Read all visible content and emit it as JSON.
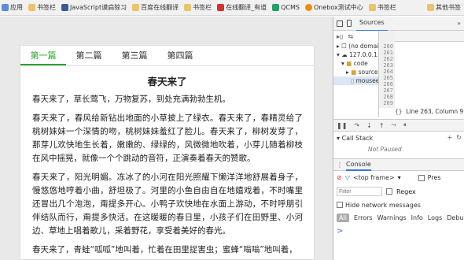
{
  "bookmarks": [
    {
      "icon": "apps-icon",
      "label": "应用"
    },
    {
      "icon": "folder-icon",
      "label": "书签栏"
    },
    {
      "icon": "facebook-icon",
      "label": "JavaScript谟扃猄习"
    },
    {
      "icon": "folder-icon",
      "label": "百度在线翻译"
    },
    {
      "icon": "folder-icon",
      "label": "书签栏"
    },
    {
      "icon": "youdao-icon",
      "label": "在线翻译_有道"
    },
    {
      "icon": "qcms-icon",
      "label": "QCMS"
    },
    {
      "icon": "onebox-icon",
      "label": "Onebox测试中心"
    },
    {
      "icon": "folder-icon",
      "label": "书签栏"
    }
  ],
  "bookmarks_right": "其他书签",
  "article": {
    "tabs": [
      {
        "label": "第一篇",
        "active": true
      },
      {
        "label": "第二篇",
        "active": false
      },
      {
        "label": "第三篇",
        "active": false
      },
      {
        "label": "第四篇",
        "active": false
      }
    ],
    "title": "春天来了",
    "paragraphs": [
      "春天来了，草长莺飞，万物复苏，到处充满勃勃生机。",
      "春天来了，春风给新钻出地面的小草披上了绿衣。春天来了，春精灵给了桃树妹妹一个深情的吻，桃树妹妹羞红了脸儿。春天来了，柳树发芽了，那芽儿欢快地生长着，嫩嫩的、绿绿的，风微微地吹着，小芽儿随着柳枝在风中摇晃，就像一个个跳动的音符，正演奏着春天的赞歌。",
      "春天来了，阳光明媚。冻冰了的小河在阳光照耀下懒洋洋地舒展着身子，慢悠悠地哼着小曲，舒坦极了。河里的小鱼自由自在地嬉戏着，不时嘴里还冒出几个泡泡，甭提多开心。小鸭子欢快地在水面上游动，不时呼朋引伴结队而行，甭提多快活。在这暖暖的春日里，小孩子们在田野里、小河边、草地上唱着歌儿，采着野花，享受着美好的春光。",
      "春天来了，青蛙“呱呱”地叫着，忙着在田里捉害虫；蜜蜂“嗡嗡”地叫着，"
    ]
  },
  "devtools": {
    "top_tabs": [
      "Sources",
      "»"
    ],
    "nav_items": [
      "(no domain",
      "127.0.0.1:8",
      "code",
      "source",
      "mouseev"
    ],
    "line_numbers": [
      "260",
      "261",
      "262",
      "263",
      "264",
      "265",
      "266",
      "267",
      "268",
      "269"
    ],
    "status": "Line 263, Column 9",
    "call_stack_label": "Call Stack",
    "call_stack_body": "Not Paused",
    "console_tab": "Console",
    "frame": "<top frame>",
    "preserve": "Pres",
    "filter_placeholder": "Filter",
    "regex_label": "Regex",
    "hide_network_label": "Hide network messages",
    "levels": [
      "All",
      "Errors",
      "Warnings",
      "Info",
      "Logs",
      "Debug"
    ],
    "prompt": ">"
  }
}
